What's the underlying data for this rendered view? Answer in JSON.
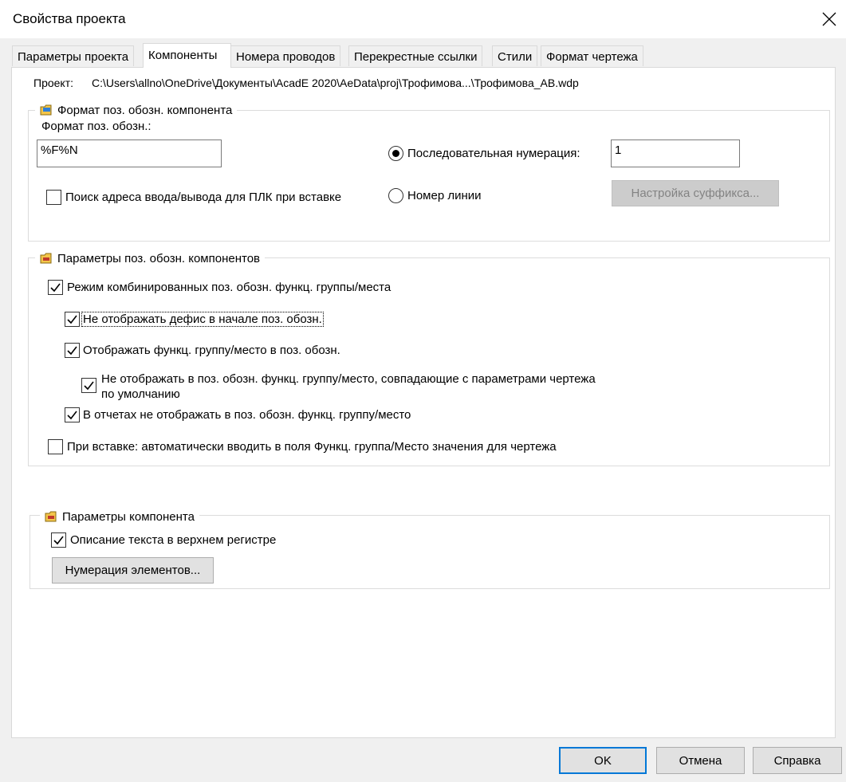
{
  "window": {
    "title": "Свойства проекта"
  },
  "tabs": [
    {
      "label": "Параметры проекта"
    },
    {
      "label": "Компоненты"
    },
    {
      "label": "Номера проводов"
    },
    {
      "label": "Перекрестные ссылки"
    },
    {
      "label": "Стили"
    },
    {
      "label": "Формат чертежа"
    }
  ],
  "project": {
    "label": "Проект:",
    "path": "C:\\Users\\allno\\OneDrive\\Документы\\AcadE 2020\\AeData\\proj\\Трофимова...\\Трофимова_AB.wdp"
  },
  "format_group": {
    "title": "Формат поз. обозн. компонента",
    "format_label": "Формат поз. обозн.:",
    "format_value": "%F%N",
    "sequential_label": "Последовательная нумерация:",
    "sequential_value": "1",
    "line_number_label": "Номер линии",
    "plc_search_label": "Поиск адреса ввода/вывода для ПЛК при вставке",
    "suffix_button": "Настройка суффикса..."
  },
  "tag_params_group": {
    "title": "Параметры поз. обозн. компонентов",
    "combined_mode": "Режим комбинированных поз. обозн. функц. группы/места",
    "no_dash": "Не отображать дефис в начале поз. обозн.",
    "show_group": "Отображать функц. группу/место в поз. обозн.",
    "hide_matching_line1": "Не отображать в поз. обозн. функц. группу/место, совпадающие с параметрами чертежа",
    "hide_matching_line2": "по умолчанию",
    "reports_hide": "В отчетах не отображать в поз. обозн. функц. группу/место",
    "auto_insert": "При вставке: автоматически вводить в поля Функц. группа/Место значения для чертежа"
  },
  "component_group": {
    "title": "Параметры компонента",
    "uppercase": "Описание текста в верхнем регистре",
    "numbering_button": "Нумерация элементов..."
  },
  "footer": {
    "ok": "OK",
    "cancel": "Отмена",
    "help": "Справка"
  },
  "colors": {
    "accent": "#0078d7",
    "background": "#f0f0f0",
    "disabled_text": "#838383"
  },
  "icons": {
    "close": "close-icon",
    "folder": "folder-icon",
    "check": "checkmark-icon"
  }
}
